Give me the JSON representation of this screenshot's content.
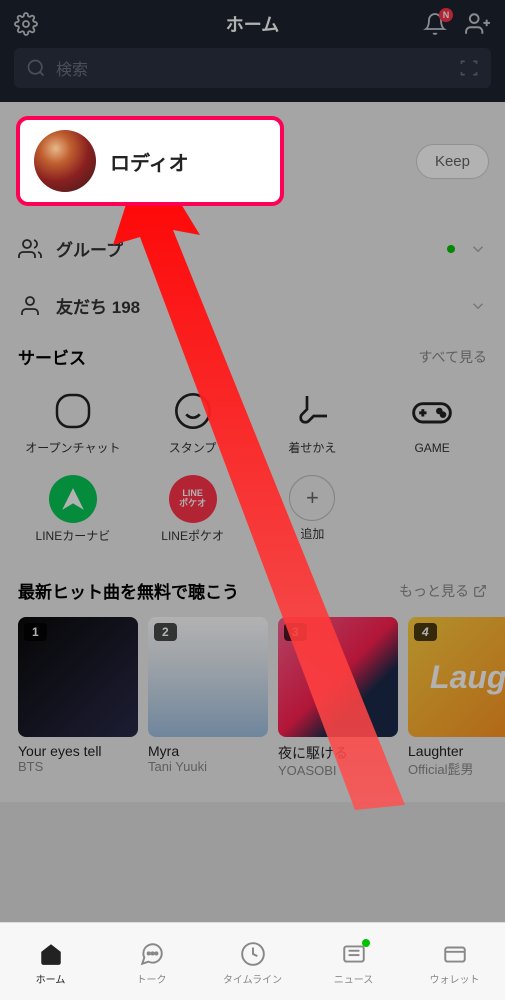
{
  "header": {
    "title": "ホーム",
    "badge": "N"
  },
  "search": {
    "placeholder": "検索"
  },
  "profile": {
    "name": "ロディオ",
    "keep": "Keep"
  },
  "sections": {
    "groups": "グループ",
    "friends_label": "友だち",
    "friends_count": "198"
  },
  "services": {
    "title": "サービス",
    "see_all": "すべて見る",
    "items": [
      {
        "label": "オープンチャット"
      },
      {
        "label": "スタンプ"
      },
      {
        "label": "着せかえ"
      },
      {
        "label": "GAME"
      },
      {
        "label": "LINEカーナビ"
      },
      {
        "label": "LINEポケオ",
        "sub1": "LINE",
        "sub2": "ポケオ"
      },
      {
        "label": "追加"
      }
    ]
  },
  "music": {
    "title": "最新ヒット曲を無料で聴こう",
    "more": "もっと見る",
    "tracks": [
      {
        "rank": "1",
        "title": "Your eyes tell",
        "artist": "BTS"
      },
      {
        "rank": "2",
        "title": "Myra",
        "artist": "Tani Yuuki"
      },
      {
        "rank": "3",
        "title": "夜に駆ける",
        "artist": "YOASOBI"
      },
      {
        "rank": "4",
        "title": "Laughter",
        "artist": "Official髭男"
      }
    ],
    "cover4_text": "Laugh"
  },
  "tabs": {
    "home": "ホーム",
    "talk": "トーク",
    "timeline": "タイムライン",
    "news": "ニュース",
    "wallet": "ウォレット"
  }
}
